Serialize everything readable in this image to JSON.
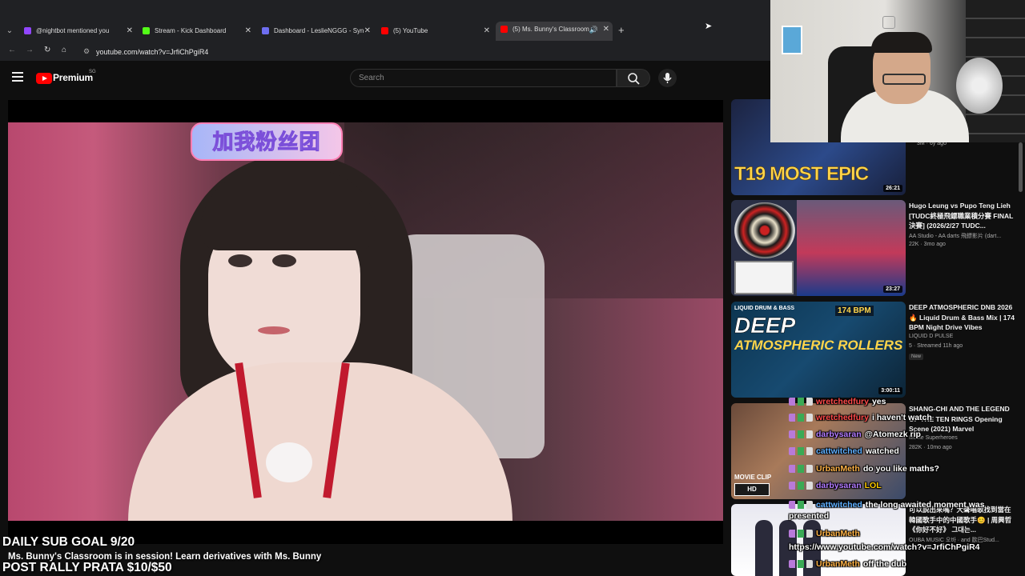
{
  "browser": {
    "tabs": [
      {
        "label": "@nightbot mentioned you",
        "favicon_color": "#9146ff"
      },
      {
        "label": "Stream - Kick Dashboard",
        "favicon_color": "#53fc18"
      },
      {
        "label": "Dashboard - LeslieNGGG - Syn",
        "favicon_color": "#6e6ef0"
      },
      {
        "label": "(5) YouTube",
        "favicon_color": "#ff0000"
      },
      {
        "label": "(5) Ms. Bunny's Classroom",
        "favicon_color": "#ff0000",
        "active": true
      }
    ],
    "new_tab": "+",
    "url": "youtube.com/watch?v=JrfiChPgiR4"
  },
  "youtube": {
    "brand": "Premium",
    "region": "SG",
    "search_placeholder": "Search"
  },
  "video": {
    "overlay_sign": "加我粉丝团"
  },
  "recommendations": [
    {
      "title": "",
      "channel": "",
      "meta": "3M · 6y ago",
      "duration": "26:21",
      "thumb_text": "T19 MOST EPIC"
    },
    {
      "title": "Hugo Leung vs Pupo Teng Lieh [TUDC終極飛鏢職業積分賽 FINAL 決賽] (2026/2/27 TUDC...",
      "channel": "AA Studio - AA darts 飛鏢影片 (dart...",
      "meta": "22K · 3mo ago",
      "duration": "23:27"
    },
    {
      "title": "DEEP ATMOSPHERIC DNB 2026 🔥 Liquid Drum & Bass Mix | 174 BPM Night Drive Vibes",
      "channel": "LIQUID D PULSE",
      "meta": "5 · Streamed 11h ago",
      "badge": "New",
      "duration": "3:00:11",
      "thumb_text": "DEEP",
      "thumb_text2": "ATMOSPHERIC ROLLERS",
      "thumb_bpm": "174 BPM",
      "thumb_liquid": "LIQUID DRUM & BASS"
    },
    {
      "title": "SHANG-CHI AND THE LEGEND OF THE TEN RINGS Opening Scene (2021) Marvel",
      "channel": "Movie Superheroes",
      "meta": "282K · 10mo ago",
      "thumb_text": "MOVIE CLIP",
      "thumb_hd": "HD"
    },
    {
      "title": "可以説出來嗎？大聲唱歌找到當在韓國歌手中的中國歌手😊 | 周興哲《你好不好》 그대는...",
      "channel": "OUBA MUSIC 오바 · and 歐巴Stud...",
      "meta": ""
    }
  ],
  "chat": [
    {
      "user": "wretchedfury",
      "color": "#ff4a4a",
      "message": "yes"
    },
    {
      "user": "wretchedfury",
      "color": "#ff4a4a",
      "message": "i haven't watch"
    },
    {
      "user": "darbysaran",
      "color": "#b37bff",
      "message": "@Atomezk rip"
    },
    {
      "user": "cattwitched",
      "color": "#5fb0ff",
      "message": "watched"
    },
    {
      "user": "UrbanMeth",
      "color": "#ffb347",
      "message": "do you like maths?"
    },
    {
      "user": "darbysaran",
      "color": "#b37bff",
      "message": "LOL"
    },
    {
      "user": "cattwitched",
      "color": "#5fb0ff",
      "message": "the long awaited moment was presented"
    },
    {
      "user": "UrbanMeth",
      "color": "#ffb347",
      "message": ""
    },
    {
      "user": "UrbanMeth",
      "color": "#ffb347",
      "message": "https://www.youtube.com/watch?v=JrfiChPgiR4"
    },
    {
      "user": "UrbanMeth",
      "color": "#ffb347",
      "message": "off the dub"
    }
  ],
  "overlay": {
    "goal": "DAILY SUB GOAL 9/20",
    "ticker": "Ms. Bunny's Classroom is in session! Learn derivatives with Ms. Bunny",
    "rally": "POST RALLY PRATA $10/$50"
  }
}
